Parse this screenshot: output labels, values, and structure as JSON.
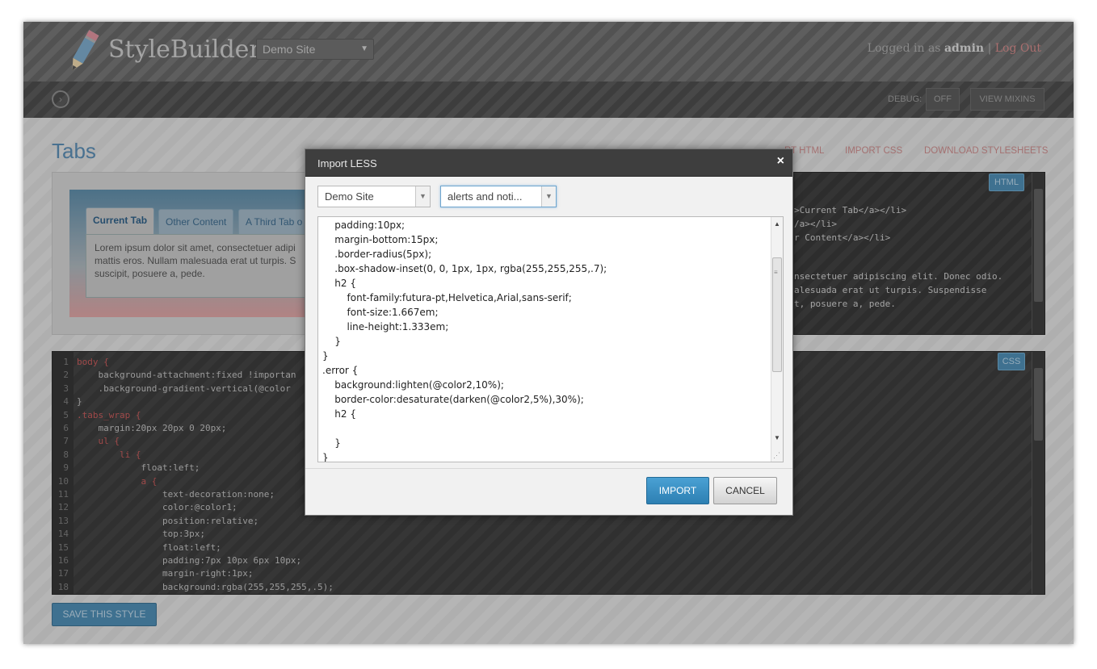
{
  "app": {
    "brand": "StyleBuilder",
    "site_select": "Demo Site",
    "login_prefix": "Logged in as",
    "user": "admin",
    "separator": "|",
    "logout": "Log Out"
  },
  "toolbar": {
    "debug_label": "DEBUG:",
    "debug_value": "OFF",
    "view_mixins": "VIEW MIXINS"
  },
  "page": {
    "title": "Tabs",
    "links": [
      "RT HTML",
      "IMPORT CSS",
      "DOWNLOAD STYLESHEETS"
    ],
    "save_button": "SAVE THIS STYLE"
  },
  "preview": {
    "tabs": [
      "Current Tab",
      "Other Content",
      "A Third Tab o"
    ],
    "panel_text": "Lorem ipsum dolor sit amet, consectetuer adipi mattis eros. Nullam malesuada erat ut turpis. S suscipit, posuere a, pede."
  },
  "html_editor": {
    "badge": "HTML",
    "lines": [
      ">Current Tab</a></li>",
      "/a></li>",
      "r Content</a></li>",
      "",
      "",
      "nsectetuer adipiscing elit. Donec odio.",
      "alesuada erat ut turpis. Suspendisse",
      "t, posuere a, pede."
    ]
  },
  "css_editor": {
    "badge": "CSS",
    "line_numbers": [
      "1",
      "2",
      "3",
      "4",
      "5",
      "6",
      "7",
      "8",
      "9",
      "10",
      "11",
      "12",
      "13",
      "14",
      "15",
      "16",
      "17",
      "18"
    ],
    "lines": [
      "body {",
      "    background-attachment:fixed !importan",
      "    .background-gradient-vertical(@color",
      "}",
      ".tabs_wrap {",
      "    margin:20px 20px 0 20px;",
      "    ul {",
      "        li {",
      "            float:left;",
      "            a {",
      "                text-decoration:none;",
      "                color:@color1;",
      "                position:relative;",
      "                top:3px;",
      "                float:left;",
      "                padding:7px 10px 6px 10px;",
      "                margin-right:1px;",
      "                background:rgba(255,255,255,.5);"
    ]
  },
  "modal": {
    "title": "Import LESS",
    "close": "×",
    "site_dropdown": "Demo Site",
    "file_dropdown": "alerts and noti...",
    "code_lines": [
      "    padding:10px;",
      "    margin-bottom:15px;",
      "    .border-radius(5px);",
      "    .box-shadow-inset(0, 0, 1px, 1px, rgba(255,255,255,.7);",
      "    h2 {",
      "        font-family:futura-pt,Helvetica,Arial,sans-serif;",
      "        font-size:1.667em;",
      "        line-height:1.333em;",
      "    }",
      "}",
      ".error {",
      "    background:lighten(@color2,10%);",
      "    border-color:desaturate(darken(@color2,5%),30%);",
      "    h2 {",
      "",
      "    }",
      "}"
    ],
    "import_button": "IMPORT",
    "cancel_button": "CANCEL"
  },
  "colors": {
    "accent_blue": "#2d7fb2",
    "link_red": "#c88a8a",
    "header_gray": "#6a6a6a"
  }
}
